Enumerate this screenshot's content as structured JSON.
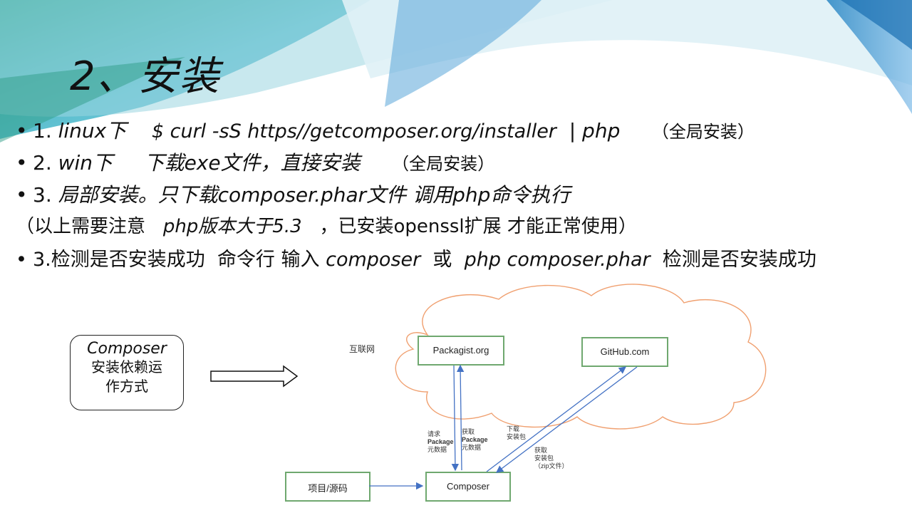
{
  "slide": {
    "title": "2、安装",
    "bullets": [
      {
        "num": "1.",
        "parts": [
          "linux下",
          "$ curl -sS https//getcomposer.org/installer",
          "| php",
          "（全局安装）"
        ]
      },
      {
        "num": "2.",
        "parts": [
          "win下",
          "下载exe文件，直接安装",
          "（全局安装）"
        ]
      },
      {
        "num": "3.",
        "parts": [
          "局部安装。只下载composer.phar文件 调用php命令执行"
        ]
      },
      {
        "num": "",
        "parts": [
          "（以上需要注意",
          "php版本大于5.3",
          "，已安装openssl扩展 才能正常使用）"
        ]
      },
      {
        "num": "3.",
        "parts": [
          "检测是否安装成功",
          "命令行",
          "输入",
          "composer",
          "或",
          "php composer.phar",
          "检测是否安装成功"
        ]
      }
    ]
  },
  "diagram": {
    "left_box": {
      "line1": "Composer",
      "line2": "安装依赖运",
      "line3": "作方式"
    },
    "cloud_label": "互联网",
    "packagist": "Packagist.org",
    "github": "GitHub.com",
    "project": "项目/源码",
    "composer": "Composer",
    "lbl_request": [
      "请求",
      "Package",
      "元数据"
    ],
    "lbl_get": [
      "获取",
      "Package",
      "元数据"
    ],
    "lbl_download": [
      "下载",
      "安装包"
    ],
    "lbl_zip": [
      "获取",
      "安装包",
      "（zip文件）"
    ]
  },
  "colors": {
    "bg_teal": "#5fb9c9",
    "bg_green": "#7cc8a6",
    "bg_blue": "#6aa7d6",
    "cloud": "#f0a070",
    "arrow": "#4472c4",
    "box_border": "#6fa86f"
  }
}
